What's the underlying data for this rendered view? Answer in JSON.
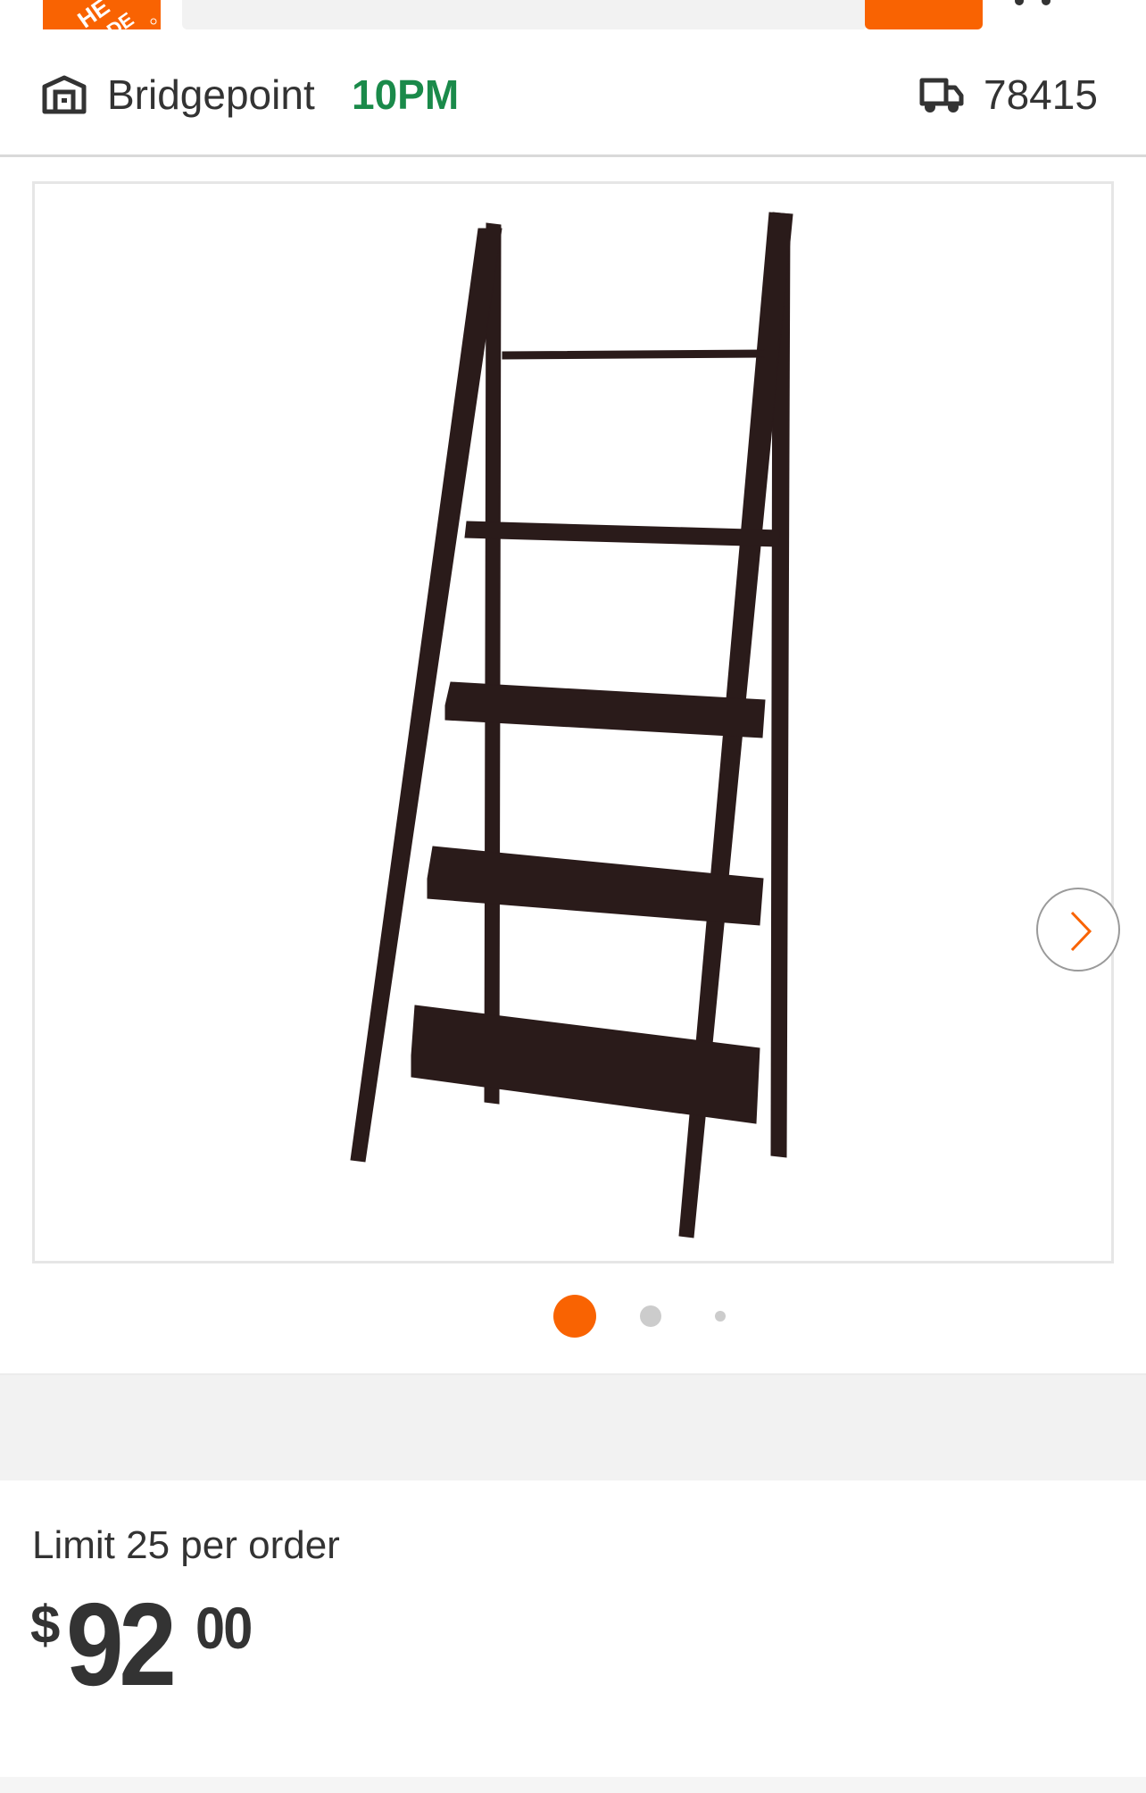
{
  "header": {
    "logo_icon": "home-depot-logo",
    "logo_text": "THE HOME DEPOT",
    "brand_color": "#f96302",
    "cart_icon": "cart-icon"
  },
  "store_bar": {
    "store_icon": "store-icon",
    "store_name": "Bridgepoint",
    "store_hours": "10PM",
    "hours_color": "#1a8a4a",
    "delivery_icon": "truck-icon",
    "zip_code": "78415"
  },
  "gallery": {
    "product_image": "ladder-bookshelf-espresso",
    "next_icon": "chevron-right-icon",
    "dots_count": 3,
    "active_dot_index": 0,
    "active_dot_color": "#f96302"
  },
  "pricing": {
    "limit_text": "Limit 25 per order",
    "currency": "$",
    "dollars": "92",
    "cents": "00"
  }
}
